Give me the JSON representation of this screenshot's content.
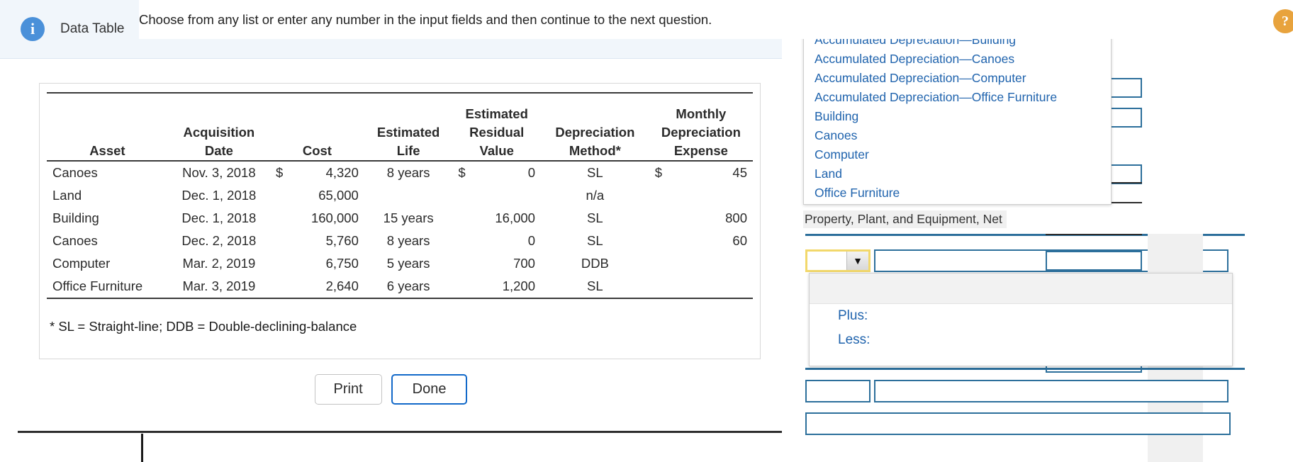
{
  "instruction_banner": {
    "text": "Choose from any list or enter any number in the input fields and then continue to the next question."
  },
  "modal": {
    "info_icon": "info-icon",
    "title": "Data Table",
    "footnote": "* SL = Straight-line; DDB = Double-declining-balance",
    "buttons": {
      "print": "Print",
      "done": "Done"
    }
  },
  "data_table": {
    "header_row1": [
      "",
      "",
      "",
      "",
      "Estimated",
      "",
      "Monthly"
    ],
    "header_row2": [
      "",
      "Acquisition",
      "",
      "Estimated",
      "Residual",
      "Depreciation",
      "Depreciation"
    ],
    "header_row3": [
      "Asset",
      "Date",
      "Cost",
      "Life",
      "Value",
      "Method*",
      "Expense"
    ],
    "rows": [
      {
        "asset": "Canoes",
        "date": "Nov. 3, 2018",
        "cost_currency": "$",
        "cost": "4,320",
        "life": "8 years",
        "residual_currency": "$",
        "residual": "0",
        "method": "SL",
        "expense_currency": "$",
        "expense": "45"
      },
      {
        "asset": "Land",
        "date": "Dec. 1, 2018",
        "cost_currency": "",
        "cost": "65,000",
        "life": "",
        "residual_currency": "",
        "residual": "",
        "method": "n/a",
        "expense_currency": "",
        "expense": ""
      },
      {
        "asset": "Building",
        "date": "Dec. 1, 2018",
        "cost_currency": "",
        "cost": "160,000",
        "life": "15 years",
        "residual_currency": "",
        "residual": "16,000",
        "method": "SL",
        "expense_currency": "",
        "expense": "800"
      },
      {
        "asset": "Canoes",
        "date": "Dec. 2, 2018",
        "cost_currency": "",
        "cost": "5,760",
        "life": "8 years",
        "residual_currency": "",
        "residual": "0",
        "method": "SL",
        "expense_currency": "",
        "expense": "60"
      },
      {
        "asset": "Computer",
        "date": "Mar. 2, 2019",
        "cost_currency": "",
        "cost": "6,750",
        "life": "5 years",
        "residual_currency": "",
        "residual": "700",
        "method": "DDB",
        "expense_currency": "",
        "expense": ""
      },
      {
        "asset": "Office Furniture",
        "date": "Mar. 3, 2019",
        "cost_currency": "",
        "cost": "2,640",
        "life": "6 years",
        "residual_currency": "",
        "residual": "1,200",
        "method": "SL",
        "expense_currency": "",
        "expense": ""
      }
    ]
  },
  "worksheet": {
    "help_icon": "?",
    "account_listbox": {
      "options": [
        "Accumulated Depreciation—Building",
        "Accumulated Depreciation—Canoes",
        "Accumulated Depreciation—Computer",
        "Accumulated Depreciation—Office Furniture",
        "Building",
        "Canoes",
        "Computer",
        "Land",
        "Office Furniture"
      ]
    },
    "ppe_net_label": "Property, Plant, and Equipment, Net",
    "plus_less_listbox": {
      "blank_option": "",
      "options": [
        "Plus:",
        "Less:"
      ]
    },
    "combo": {
      "selected_value": "",
      "text_value": ""
    },
    "row2": {
      "small_value": "",
      "text_value": ""
    },
    "row3_value": ""
  },
  "colors": {
    "accent_blue": "#1f63ad",
    "field_border": "#2c6f9b",
    "focus_yellow": "#f2d86b",
    "info_blue": "#4a90d9",
    "help_orange": "#e8a33d",
    "banner_bg": "#f1f6fb"
  }
}
